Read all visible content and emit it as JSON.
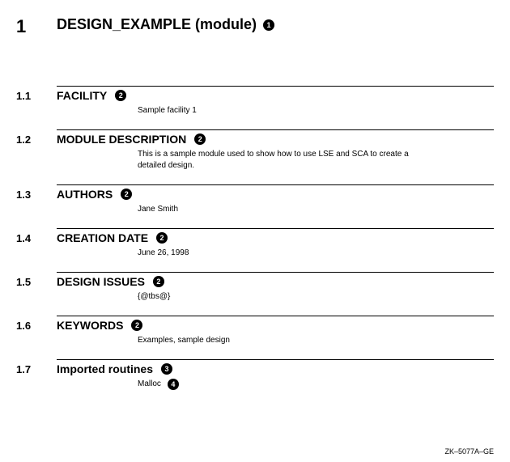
{
  "doc_id": "ZK–5077A–GE",
  "main": {
    "number": "1",
    "title": "DESIGN_EXAMPLE (module)",
    "callout": "1"
  },
  "sections": [
    {
      "number": "1.1",
      "heading": "FACILITY",
      "callout": "2",
      "body": "Sample facility 1"
    },
    {
      "number": "1.2",
      "heading": "MODULE DESCRIPTION",
      "callout": "2",
      "body": "This is a sample module used to show how to use LSE and SCA to create a detailed design."
    },
    {
      "number": "1.3",
      "heading": "AUTHORS",
      "callout": "2",
      "body": "Jane Smith"
    },
    {
      "number": "1.4",
      "heading": "CREATION DATE",
      "callout": "2",
      "body": "June 26, 1998"
    },
    {
      "number": "1.5",
      "heading": "DESIGN ISSUES",
      "callout": "2",
      "body": "{@tbs@}"
    },
    {
      "number": "1.6",
      "heading": "KEYWORDS",
      "callout": "2",
      "body": "Examples, sample design"
    },
    {
      "number": "1.7",
      "heading": "Imported routines",
      "callout": "3",
      "body": "Malloc",
      "body_callout": "4"
    }
  ]
}
